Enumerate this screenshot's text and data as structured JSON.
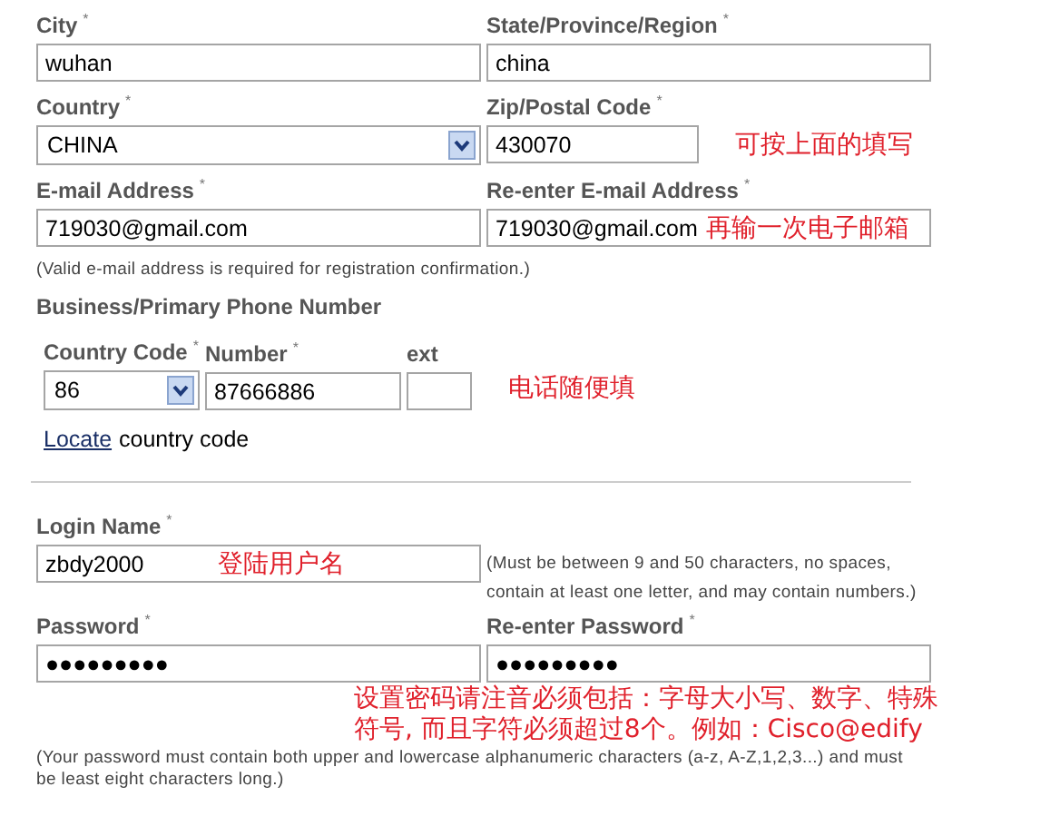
{
  "address_fields": [
    {
      "kind": "text",
      "label": "City",
      "required": "*",
      "value": "wuhan"
    },
    {
      "kind": "text",
      "label": "State/Province/Region",
      "required": "*",
      "value": "china"
    },
    {
      "kind": "select",
      "label": "Country",
      "required": "*",
      "value": "CHINA"
    },
    {
      "kind": "short",
      "label": "Zip/Postal Code",
      "required": "*",
      "value": "430070",
      "annotation": "可按上面的填写"
    },
    {
      "kind": "text",
      "label": "E-mail Address",
      "required": "*",
      "value": "719030@gmail.com"
    },
    {
      "kind": "text",
      "label": "Re-enter E-mail Address",
      "required": "*",
      "value": "719030@gmail.com",
      "overlay": "再输一次电子邮箱"
    }
  ],
  "email_note": "(Valid e-mail address is required for registration confirmation.)",
  "phone": {
    "title": "Business/Primary Phone Number",
    "fields": [
      {
        "kind": "select",
        "label": "Country Code",
        "required": "*",
        "value": "86"
      },
      {
        "kind": "text",
        "label": "Number",
        "required": "*",
        "value": "87666886"
      },
      {
        "kind": "text",
        "label": "ext"
      }
    ],
    "annotation": "电话随便填",
    "locate_link": "Locate",
    "locate_text": "country code"
  },
  "login": {
    "label": "Login Name",
    "required": "*",
    "value": "zbdy2000",
    "overlay": "登陆用户名",
    "help": "(Must be between 9 and 50 characters, no spaces, contain at least one letter, and may contain numbers.)"
  },
  "passwords": [
    {
      "label": "Password",
      "required": "*",
      "value": "●●●●●●●●●"
    },
    {
      "label": "Re-enter Password",
      "required": "*",
      "value": "●●●●●●●●●"
    }
  ],
  "password_note": "(Your password must contain both upper and lowercase alphanumeric characters (a-z, A-Z,1,2,3...) and must be least eight characters long.)",
  "password_annotation": [
    "设置密码请注音必须包括：字母大小写、数字、特殊",
    "符号, 而且字符必须超过8个。例如：Cisco@edify"
  ]
}
